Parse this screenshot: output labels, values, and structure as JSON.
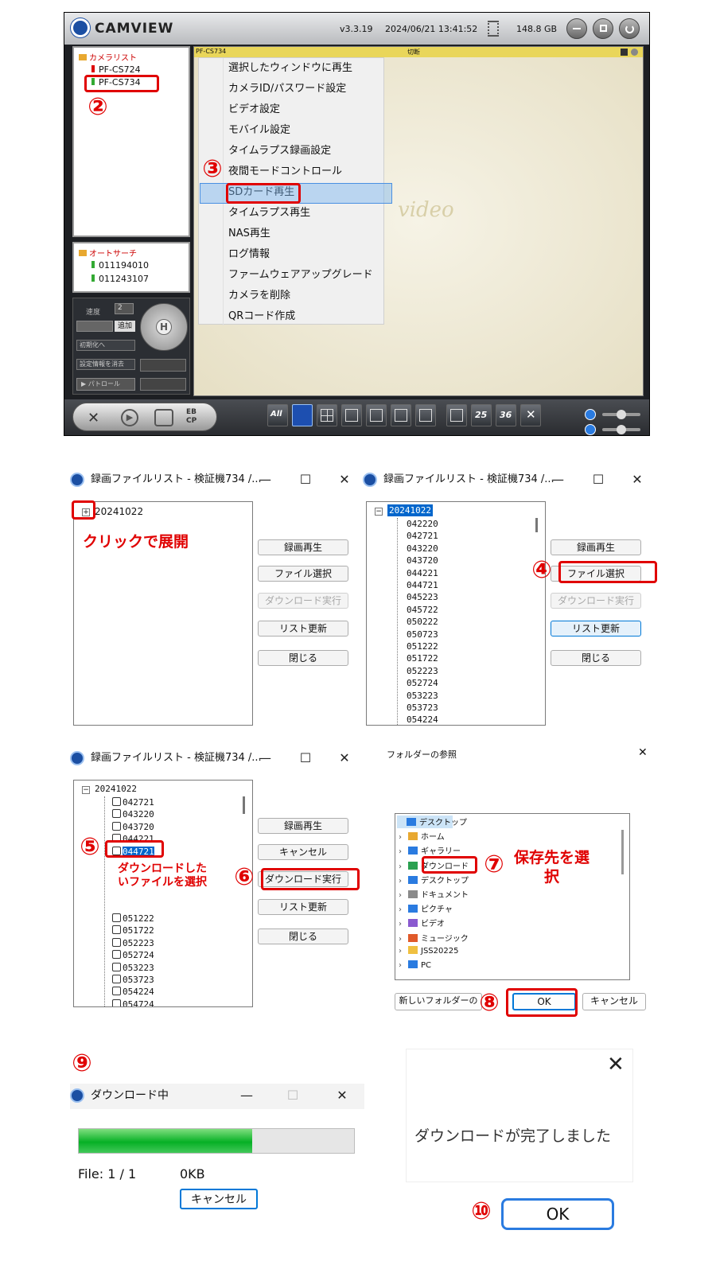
{
  "camview": {
    "brand": "CAMVIEW",
    "version": "v3.3.19",
    "datetime": "2024/06/21 13:41:52",
    "storage": "148.8 GB",
    "camera_list_title": "カメラリスト",
    "cameras": [
      "PF-CS724",
      "PF-CS734"
    ],
    "auto_search_title": "オートサーチ",
    "auto_search_items": [
      "011194010",
      "011243107"
    ],
    "speed_label": "速度",
    "speed_value": "2",
    "add_label": "追加",
    "init_label": "初期化へ",
    "clear_label": "設定情報を消去",
    "patrol_label": "パトロール",
    "video_header_left": "PF-CS734",
    "video_header_mid": "切断",
    "watermark": "video",
    "context_menu": [
      "選択したウィンドウに再生",
      "カメラID/パスワード設定",
      "ビデオ設定",
      "モバイル設定",
      "タイムラプス録画設定",
      "夜間モードコントロール",
      "SDカード再生",
      "タイムラプス再生",
      "NAS再生",
      "ログ情報",
      "ファームウェアアップグレード",
      "カメラを削除",
      "QRコード作成"
    ],
    "toolbar_all": "All",
    "toolbar_25": "25",
    "toolbar_36": "36",
    "toolbar_lang": "EB\nCP"
  },
  "steps": {
    "s2": "②",
    "s3": "③",
    "s4": "④",
    "s5": "⑤",
    "s6": "⑥",
    "s7": "⑦",
    "s8": "⑧",
    "s9": "⑨",
    "s10": "⑩"
  },
  "notes": {
    "expand": "クリックで展開",
    "select_file": "ダウンロードした\nいファイルを選択",
    "save_dest": "保存先を選\n択"
  },
  "recwin": {
    "title": "録画ファイルリスト - 検証機734 /...",
    "minimize": "—",
    "maximize": "☐",
    "close": "✕",
    "folder": "20241022",
    "play": "録画再生",
    "file_select": "ファイル選択",
    "cancel": "キャンセル",
    "download": "ダウンロード実行",
    "refresh": "リスト更新",
    "close_btn": "閉じる",
    "files_b": [
      "042220",
      "042721",
      "043220",
      "043720",
      "044221",
      "044721",
      "045223",
      "045722",
      "050222",
      "050723",
      "051222",
      "051722",
      "052223",
      "052724",
      "053223",
      "053723",
      "054224"
    ],
    "files_c_top": [
      "042721",
      "043220",
      "043720",
      "044221",
      "044721"
    ],
    "files_c_bottom": [
      "051222",
      "051722",
      "052223",
      "052724",
      "053223",
      "053723",
      "054224",
      "054724"
    ]
  },
  "folder_dialog": {
    "title": "フォルダーの参照",
    "close": "✕",
    "items": [
      "デスクトップ",
      "ホーム",
      "ギャラリー",
      "ダウンロード",
      "デスクトップ",
      "ドキュメント",
      "ピクチャ",
      "ビデオ",
      "ミュージック",
      "JSS20225",
      "PC"
    ],
    "new_folder": "新しいフォルダーの作",
    "ok": "OK",
    "cancel": "キャンセル"
  },
  "download": {
    "title": "ダウンロード中",
    "progress": 0.63,
    "file_count": "File: 1 / 1",
    "size": "0KB",
    "cancel": "キャンセル"
  },
  "complete": {
    "close": "✕",
    "message": "ダウンロードが完了しました",
    "ok": "OK"
  }
}
